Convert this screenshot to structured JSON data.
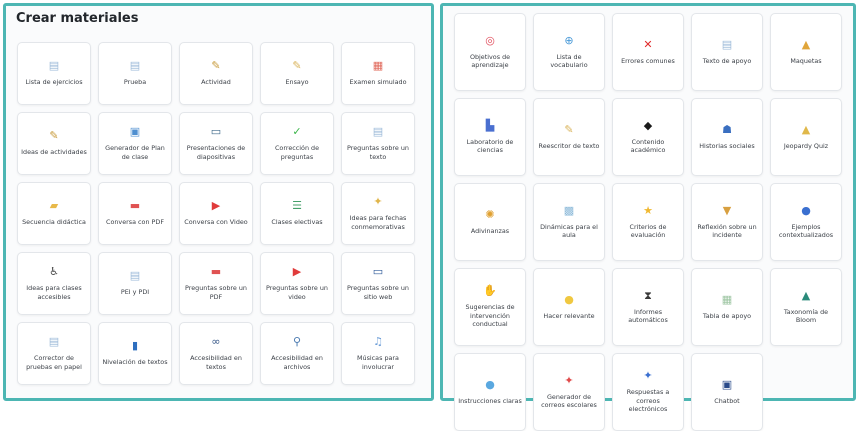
{
  "left_panel": {
    "title": "Crear materiales",
    "items": [
      {
        "label": "Lista de ejercicios",
        "icon": "document-icon",
        "glyph": "▤",
        "color": "#9bb9d8"
      },
      {
        "label": "Prueba",
        "icon": "document-icon",
        "glyph": "▤",
        "color": "#9bb9d8"
      },
      {
        "label": "Actividad",
        "icon": "pencil-icon",
        "glyph": "✎",
        "color": "#c79a3a"
      },
      {
        "label": "Ensayo",
        "icon": "pencil-paper-icon",
        "glyph": "✎",
        "color": "#d9b35a"
      },
      {
        "label": "Examen simulado",
        "icon": "exam-paper-icon",
        "glyph": "▦",
        "color": "#e0685a"
      },
      {
        "label": "Ideas de actividades",
        "icon": "pencil-icon",
        "glyph": "✎",
        "color": "#c79a3a"
      },
      {
        "label": "Generador de Plan de clase",
        "icon": "lesson-plan-icon",
        "glyph": "▣",
        "color": "#4f8fd0"
      },
      {
        "label": "Presentaciones de diapositivas",
        "icon": "presentation-icon",
        "glyph": "▭",
        "color": "#3f6a8a"
      },
      {
        "label": "Corrección de preguntas",
        "icon": "checkmark-icon",
        "glyph": "✓",
        "color": "#3bb54a"
      },
      {
        "label": "Preguntas sobre un texto",
        "icon": "document-icon",
        "glyph": "▤",
        "color": "#9bb9d8"
      },
      {
        "label": "Secuencia didáctica",
        "icon": "folder-icon",
        "glyph": "▰",
        "color": "#e8b94a"
      },
      {
        "label": "Conversa con PDF",
        "icon": "pdf-icon",
        "glyph": "▬",
        "color": "#e05252"
      },
      {
        "label": "Conversa con Video",
        "icon": "video-play-icon",
        "glyph": "▶",
        "color": "#e03b3b"
      },
      {
        "label": "Clases electivas",
        "icon": "list-icon",
        "glyph": "☰",
        "color": "#45a06a"
      },
      {
        "label": "Ideas para fechas conmemorativas",
        "icon": "calendar-icon",
        "glyph": "✦",
        "color": "#e0b54a"
      },
      {
        "label": "Ideas para clases accesibles",
        "icon": "accessibility-icon",
        "glyph": "♿",
        "color": "#4a4a4a"
      },
      {
        "label": "PEI y PDI",
        "icon": "document-icon",
        "glyph": "▤",
        "color": "#9bb9d8"
      },
      {
        "label": "Preguntas sobre un PDF",
        "icon": "pdf-icon",
        "glyph": "▬",
        "color": "#e05252"
      },
      {
        "label": "Preguntas sobre un video",
        "icon": "video-play-icon",
        "glyph": "▶",
        "color": "#e03b3b"
      },
      {
        "label": "Preguntas sobre un sitio web",
        "icon": "monitor-icon",
        "glyph": "▭",
        "color": "#2f5b9a"
      },
      {
        "label": "Corrector de pruebas en papel",
        "icon": "document-icon",
        "glyph": "▤",
        "color": "#9bb9d8"
      },
      {
        "label": "Nivelación de textos",
        "icon": "level-icon",
        "glyph": "▮",
        "color": "#2f6fbf"
      },
      {
        "label": "Accesibilidad en textos",
        "icon": "glasses-icon",
        "glyph": "∞",
        "color": "#3a5a8a"
      },
      {
        "label": "Accesibilidad en archivos",
        "icon": "magnifier-icon",
        "glyph": "⚲",
        "color": "#4a7ab0"
      },
      {
        "label": "Músicas para involucrar",
        "icon": "music-note-icon",
        "glyph": "♫",
        "color": "#6f9fd8"
      }
    ]
  },
  "right_panel": {
    "items": [
      {
        "label": "Objetivos de aprendizaje",
        "icon": "target-icon",
        "glyph": "◎",
        "color": "#e04a5a"
      },
      {
        "label": "Lista de vocabulario",
        "icon": "globe-icon",
        "glyph": "⊕",
        "color": "#4a9ad8"
      },
      {
        "label": "Errores comunes",
        "icon": "cross-icon",
        "glyph": "✕",
        "color": "#e02a2a"
      },
      {
        "label": "Texto de apoyo",
        "icon": "document-icon",
        "glyph": "▤",
        "color": "#9bb9d8"
      },
      {
        "label": "Maquetas",
        "icon": "chart-bars-icon",
        "glyph": "▲",
        "color": "#e0a53a"
      },
      {
        "label": "Laboratorio de ciencias",
        "icon": "lab-seat-icon",
        "glyph": "▙",
        "color": "#4a6fd0"
      },
      {
        "label": "Reescritor de texto",
        "icon": "pencil-paper-icon",
        "glyph": "✎",
        "color": "#d9b35a"
      },
      {
        "label": "Contenido académico",
        "icon": "graduation-cap-icon",
        "glyph": "◆",
        "color": "#1a1a1a"
      },
      {
        "label": "Historias sociales",
        "icon": "person-icon",
        "glyph": "☗",
        "color": "#3a6fc0"
      },
      {
        "label": "Jeopardy Quiz",
        "icon": "trophy-icon",
        "glyph": "▲",
        "color": "#e0b84a"
      },
      {
        "label": "Adivinanzas",
        "icon": "puzzle-icon",
        "glyph": "✺",
        "color": "#e0a030"
      },
      {
        "label": "Dinámicas para el aula",
        "icon": "classroom-icon",
        "glyph": "▩",
        "color": "#8ab8d8"
      },
      {
        "label": "Criterios de evaluación",
        "icon": "star-icon",
        "glyph": "★",
        "color": "#f0b830"
      },
      {
        "label": "Reflexión sobre un incidente",
        "icon": "incident-icon",
        "glyph": "▼",
        "color": "#d8a040"
      },
      {
        "label": "Ejemplos contextualizados",
        "icon": "bulb-icon",
        "glyph": "●",
        "color": "#3a6fd0"
      },
      {
        "label": "Sugerencias de intervención conductual",
        "icon": "hand-icon",
        "glyph": "✋",
        "color": "#e0b040"
      },
      {
        "label": "Hacer relevante",
        "icon": "lightbulb-icon",
        "glyph": "●",
        "color": "#f0c840"
      },
      {
        "label": "Informes automáticos",
        "icon": "hourglass-icon",
        "glyph": "⧗",
        "color": "#3a3a3a"
      },
      {
        "label": "Tabla de apoyo",
        "icon": "table-icon",
        "glyph": "▦",
        "color": "#9bc4a0"
      },
      {
        "label": "Taxonomía de Bloom",
        "icon": "pyramid-icon",
        "glyph": "▲",
        "color": "#2a8a7a"
      },
      {
        "label": "Instrucciones claras",
        "icon": "chat-bubble-icon",
        "glyph": "●",
        "color": "#5aa8e0"
      },
      {
        "label": "Generador de correos escolares",
        "icon": "mail-pin-icon",
        "glyph": "✦",
        "color": "#e04a4a"
      },
      {
        "label": "Respuestas a correos electrónicos",
        "icon": "mail-reply-icon",
        "glyph": "✦",
        "color": "#3a6fd0"
      },
      {
        "label": "Chatbot",
        "icon": "robot-icon",
        "glyph": "▣",
        "color": "#2a4a8a"
      }
    ]
  }
}
